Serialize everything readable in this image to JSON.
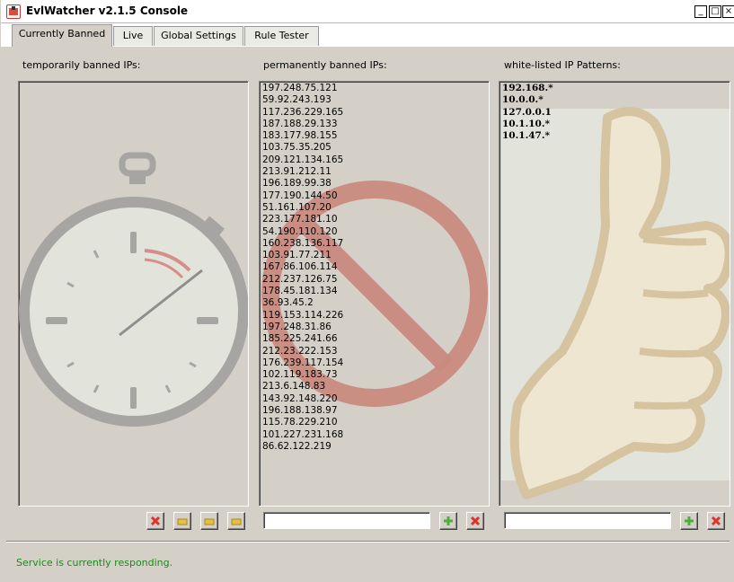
{
  "window": {
    "title": "EvlWatcher v2.1.5 Console",
    "minimize_glyph": "_",
    "maximize_glyph": "□",
    "close_glyph": "×"
  },
  "tabs": [
    {
      "label": "Currently Banned",
      "active": true
    },
    {
      "label": "Live",
      "active": false
    },
    {
      "label": "Global Settings",
      "active": false
    },
    {
      "label": "Rule Tester",
      "active": false
    }
  ],
  "temporary": {
    "label": "temporarily banned IPs:",
    "watermark_icon": "stopwatch-icon",
    "buttons": [
      "remove-icon",
      "folder-icon",
      "folder-icon",
      "folder-icon"
    ]
  },
  "permanent": {
    "label": "permanently banned IPs:",
    "watermark_icon": "prohibited-icon",
    "ips": [
      "197.248.75.121",
      "59.92.243.193",
      "117.236.229.165",
      "187.188.29.133",
      "183.177.98.155",
      "103.75.35.205",
      "209.121.134.165",
      "213.91.212.11",
      "196.189.99.38",
      "177.190.144.50",
      "51.161.107.20",
      "223.177.181.10",
      "54.190.110.120",
      "160.238.136.117",
      "103.91.77.211",
      "167.86.106.114",
      "212.237.126.75",
      "178.45.181.134",
      "36.93.45.2",
      "119.153.114.226",
      "197.248.31.86",
      "185.225.241.66",
      "212.23.222.153",
      "176.239.117.154",
      "102.119.183.73",
      "213.6.148.83",
      "143.92.148.220",
      "196.188.138.97",
      "115.78.229.210",
      "101.227.231.168",
      "86.62.122.219"
    ],
    "input_value": "",
    "buttons": [
      "add-icon",
      "remove-icon"
    ]
  },
  "whitelist": {
    "label": "white-listed IP Patterns:",
    "watermark_icon": "thumbs-up-icon",
    "patterns": [
      "192.168.*",
      "10.0.0.*",
      "127.0.0.1",
      "10.1.10.*",
      "10.1.47.*"
    ],
    "input_value": "",
    "buttons": [
      "add-icon",
      "remove-icon"
    ]
  },
  "status": {
    "text": "Service is currently responding.",
    "color": "#1a8a1a"
  },
  "colors": {
    "remove": "#e03030",
    "add": "#4caf3a",
    "folder": "#e8c040",
    "prohibited": "#c98a80",
    "stopwatch": "#a6a5a2",
    "thumb": "#d6c3a0"
  }
}
